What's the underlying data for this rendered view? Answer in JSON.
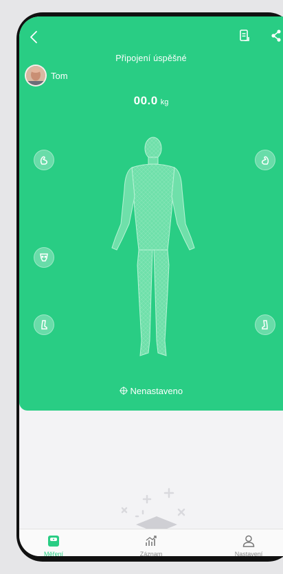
{
  "header": {
    "status_text": "Připojení úspěšné"
  },
  "user": {
    "name": "Tom"
  },
  "measurement": {
    "weight_value": "00.0",
    "weight_unit": "kg"
  },
  "body_segments": {
    "unset_label": "Nenastaveno"
  },
  "tabs": [
    {
      "label": "Měření",
      "icon": "scale-icon",
      "active": true
    },
    {
      "label": "Záznam",
      "icon": "chart-icon",
      "active": false
    },
    {
      "label": "Nastavení",
      "icon": "person-icon",
      "active": false
    }
  ],
  "colors": {
    "accent": "#29cd84",
    "background": "#f3f3f5",
    "frame": "#111111"
  }
}
